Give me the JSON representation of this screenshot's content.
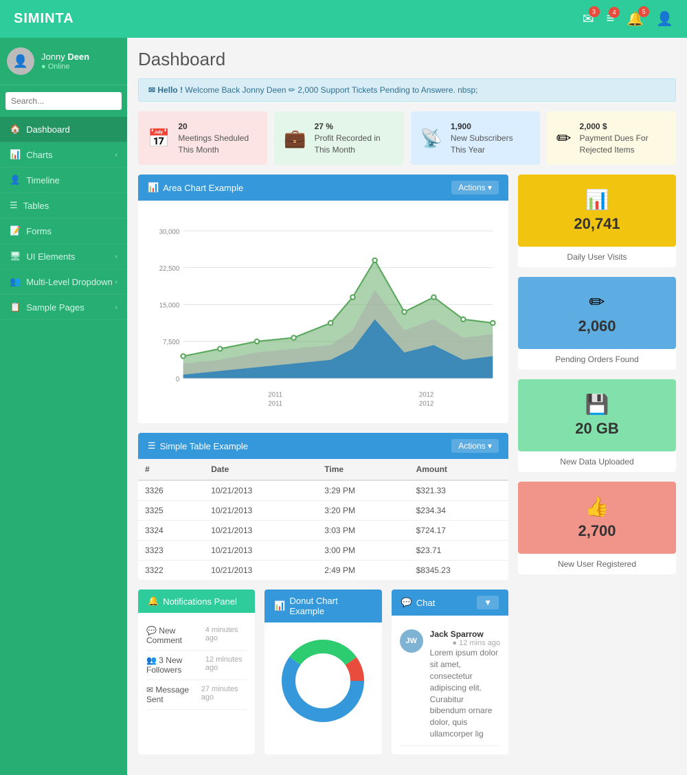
{
  "app": {
    "logo": "SIMINTA"
  },
  "topnav": {
    "icons": [
      {
        "name": "mail-icon",
        "badge": "3",
        "symbol": "✉"
      },
      {
        "name": "list-icon",
        "badge": "4",
        "symbol": "☰"
      },
      {
        "name": "bell-icon",
        "badge": "5",
        "symbol": "🔔"
      },
      {
        "name": "user-icon",
        "badge": "",
        "symbol": "👤"
      }
    ]
  },
  "sidebar": {
    "user": {
      "name_first": "Jonny ",
      "name_last": "Deen",
      "status": "Online"
    },
    "search_placeholder": "Search...",
    "nav_items": [
      {
        "id": "dashboard",
        "icon": "🏠",
        "label": "Dashboard",
        "active": true,
        "has_sub": false
      },
      {
        "id": "charts",
        "icon": "📊",
        "label": "Charts",
        "active": false,
        "has_sub": true
      },
      {
        "id": "timeline",
        "icon": "👤",
        "label": "Timeline",
        "active": false,
        "has_sub": false
      },
      {
        "id": "tables",
        "icon": "☰",
        "label": "Tables",
        "active": false,
        "has_sub": false
      },
      {
        "id": "forms",
        "icon": "📝",
        "label": "Forms",
        "active": false,
        "has_sub": false
      },
      {
        "id": "ui-elements",
        "icon": "🖥",
        "label": "UI Elements",
        "active": false,
        "has_sub": true
      },
      {
        "id": "multi-level",
        "icon": "👥",
        "label": "Multi-Level Dropdown",
        "active": false,
        "has_sub": true
      },
      {
        "id": "sample-pages",
        "icon": "📋",
        "label": "Sample Pages",
        "active": false,
        "has_sub": true
      }
    ]
  },
  "main": {
    "title": "Dashboard",
    "alert": {
      "prefix": "✉ Hello !",
      "message": " Welcome Back Jonny Deen ✏ 2,000 Support Tickets Pending to Answere. nbsp;"
    },
    "top_stats": [
      {
        "icon": "📅",
        "color": "pink",
        "value": "20",
        "label": "Meetings Sheduled This Month"
      },
      {
        "icon": "💼",
        "color": "green",
        "value": "27 %",
        "label": "Profit Recorded in This Month"
      },
      {
        "icon": "📡",
        "color": "blue",
        "value": "1,900",
        "label": "New Subscribers This Year"
      },
      {
        "icon": "✏",
        "color": "yellow",
        "value": "2,000 $",
        "label": "Payment Dues For Rejected Items"
      }
    ],
    "area_chart": {
      "title": "Area Chart Example",
      "actions_label": "Actions ▾",
      "years": [
        "2011",
        "2012"
      ],
      "y_labels": [
        "30,000",
        "22,500",
        "15,000",
        "7,500",
        "0"
      ]
    },
    "side_stats": [
      {
        "color": "yellow-bg",
        "icon": "📊",
        "number": "20,741",
        "label": "Daily User Visits"
      },
      {
        "color": "blue-bg",
        "icon": "✏",
        "number": "2,060",
        "label": "Pending Orders Found"
      },
      {
        "color": "green-bg",
        "icon": "💾",
        "number": "20 GB",
        "label": "New Data Uploaded"
      },
      {
        "color": "red-bg",
        "icon": "👍",
        "number": "2,700",
        "label": "New User Registered"
      }
    ],
    "table": {
      "title": "Simple Table Example",
      "actions_label": "Actions ▾",
      "columns": [
        "#",
        "Date",
        "Time",
        "Amount"
      ],
      "rows": [
        {
          "id": "3326",
          "date": "10/21/2013",
          "time": "3:29 PM",
          "amount": "$321.33"
        },
        {
          "id": "3325",
          "date": "10/21/2013",
          "time": "3:20 PM",
          "amount": "$234.34"
        },
        {
          "id": "3324",
          "date": "10/21/2013",
          "time": "3:03 PM",
          "amount": "$724.17"
        },
        {
          "id": "3323",
          "date": "10/21/2013",
          "time": "3:00 PM",
          "amount": "$23.71"
        },
        {
          "id": "3322",
          "date": "10/21/2013",
          "time": "2:49 PM",
          "amount": "$8345.23"
        }
      ]
    },
    "notifications": {
      "title": "Notifications Panel",
      "items": [
        {
          "icon": "💬",
          "text": "New Comment",
          "time": "4 minutes ago"
        },
        {
          "icon": "👥",
          "text": "3 New Followers",
          "time": "12 minutes ago"
        },
        {
          "icon": "✉",
          "text": "Message Sent",
          "time": "27 minutes ago"
        }
      ]
    },
    "donut_chart": {
      "title": "Donut Chart Example"
    },
    "chat": {
      "title": "Chat",
      "items": [
        {
          "avatar": "JW",
          "name": "Jack Sparrow",
          "time": "12 mins ago",
          "text": "Lorem ipsum dolor sit amet, consectetur adipiscing elit. Curabitur bibendum ornare dolor, quis ullamcorper lig"
        }
      ]
    }
  }
}
